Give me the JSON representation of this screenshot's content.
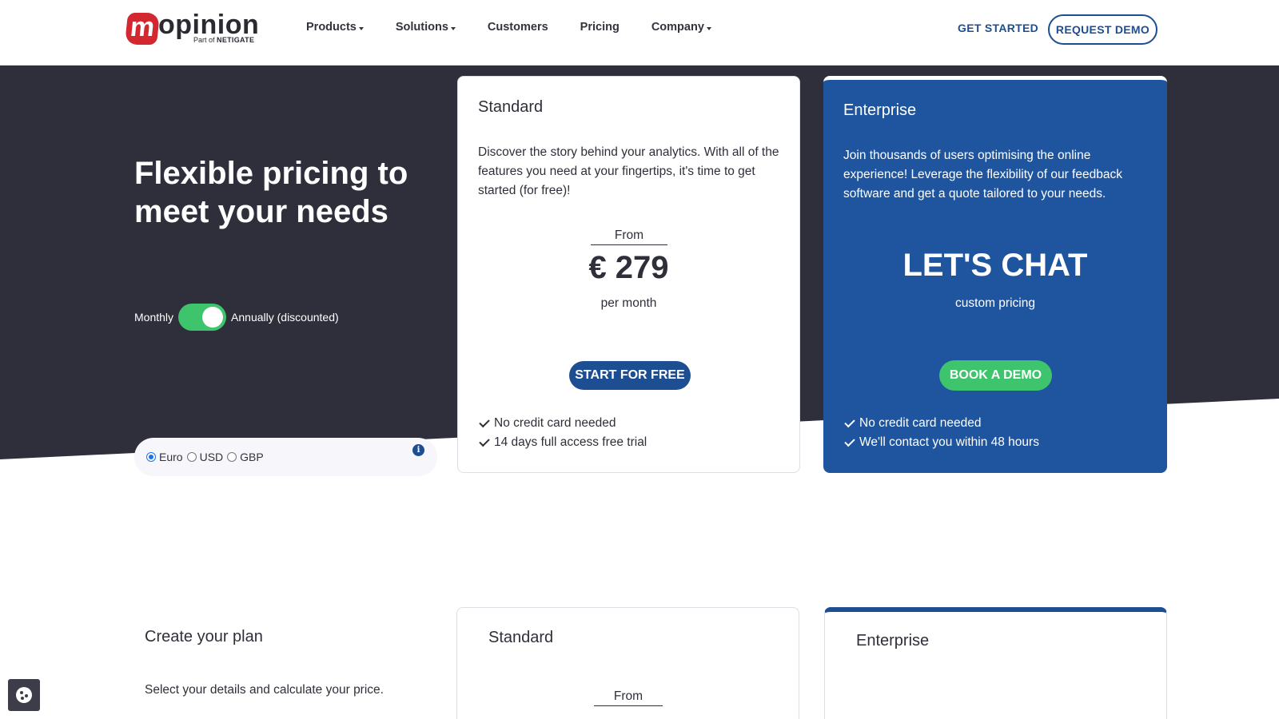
{
  "header": {
    "logo": {
      "mark": "m",
      "word": "opinion",
      "sub_prefix": "Part of",
      "sub_brand": "NETIGATE"
    },
    "nav": [
      {
        "label": "Products",
        "dropdown": true
      },
      {
        "label": "Solutions",
        "dropdown": true
      },
      {
        "label": "Customers",
        "dropdown": false
      },
      {
        "label": "Pricing",
        "dropdown": false
      },
      {
        "label": "Company",
        "dropdown": true
      }
    ],
    "get_started": "GET STARTED",
    "request_demo": "REQUEST DEMO"
  },
  "hero": {
    "title": "Flexible pricing to meet your needs",
    "billing": {
      "monthly": "Monthly",
      "annually": "Annually (discounted)",
      "annual_selected": true
    },
    "currency": {
      "options": [
        {
          "label": "Euro",
          "checked": true
        },
        {
          "label": "USD",
          "checked": false
        },
        {
          "label": "GBP",
          "checked": false
        }
      ],
      "info_icon": "info-icon"
    }
  },
  "plans": {
    "standard": {
      "name": "Standard",
      "description": "Discover the story behind your analytics. With all of the features you need at your fingertips, it's time to get started (for free)!",
      "from": "From",
      "price": "€ 279",
      "period": "per month",
      "cta": "START FOR FREE",
      "features": [
        "No credit card needed",
        "14 days full access free trial"
      ]
    },
    "enterprise": {
      "name": "Enterprise",
      "description": "Join thousands of users optimising the online experience! Leverage the flexibility of our feedback software and get a quote tailored to your needs.",
      "headline": "LET'S CHAT",
      "subline": "custom pricing",
      "cta": "BOOK A DEMO",
      "features": [
        "No credit card needed",
        "We'll contact you within 48 hours"
      ]
    }
  },
  "calculator": {
    "title": "Create your plan",
    "subtitle": "Select your details and calculate your price.",
    "standard_name": "Standard",
    "standard_from": "From",
    "enterprise_name": "Enterprise"
  },
  "colors": {
    "hero_bg": "#2e2f3b",
    "brand_blue": "#1e4e92",
    "enterprise_card": "#1e559e",
    "accent_green": "#3ec46d",
    "logo_red": "#d3282f"
  },
  "cookie_icon": "cookie-icon"
}
